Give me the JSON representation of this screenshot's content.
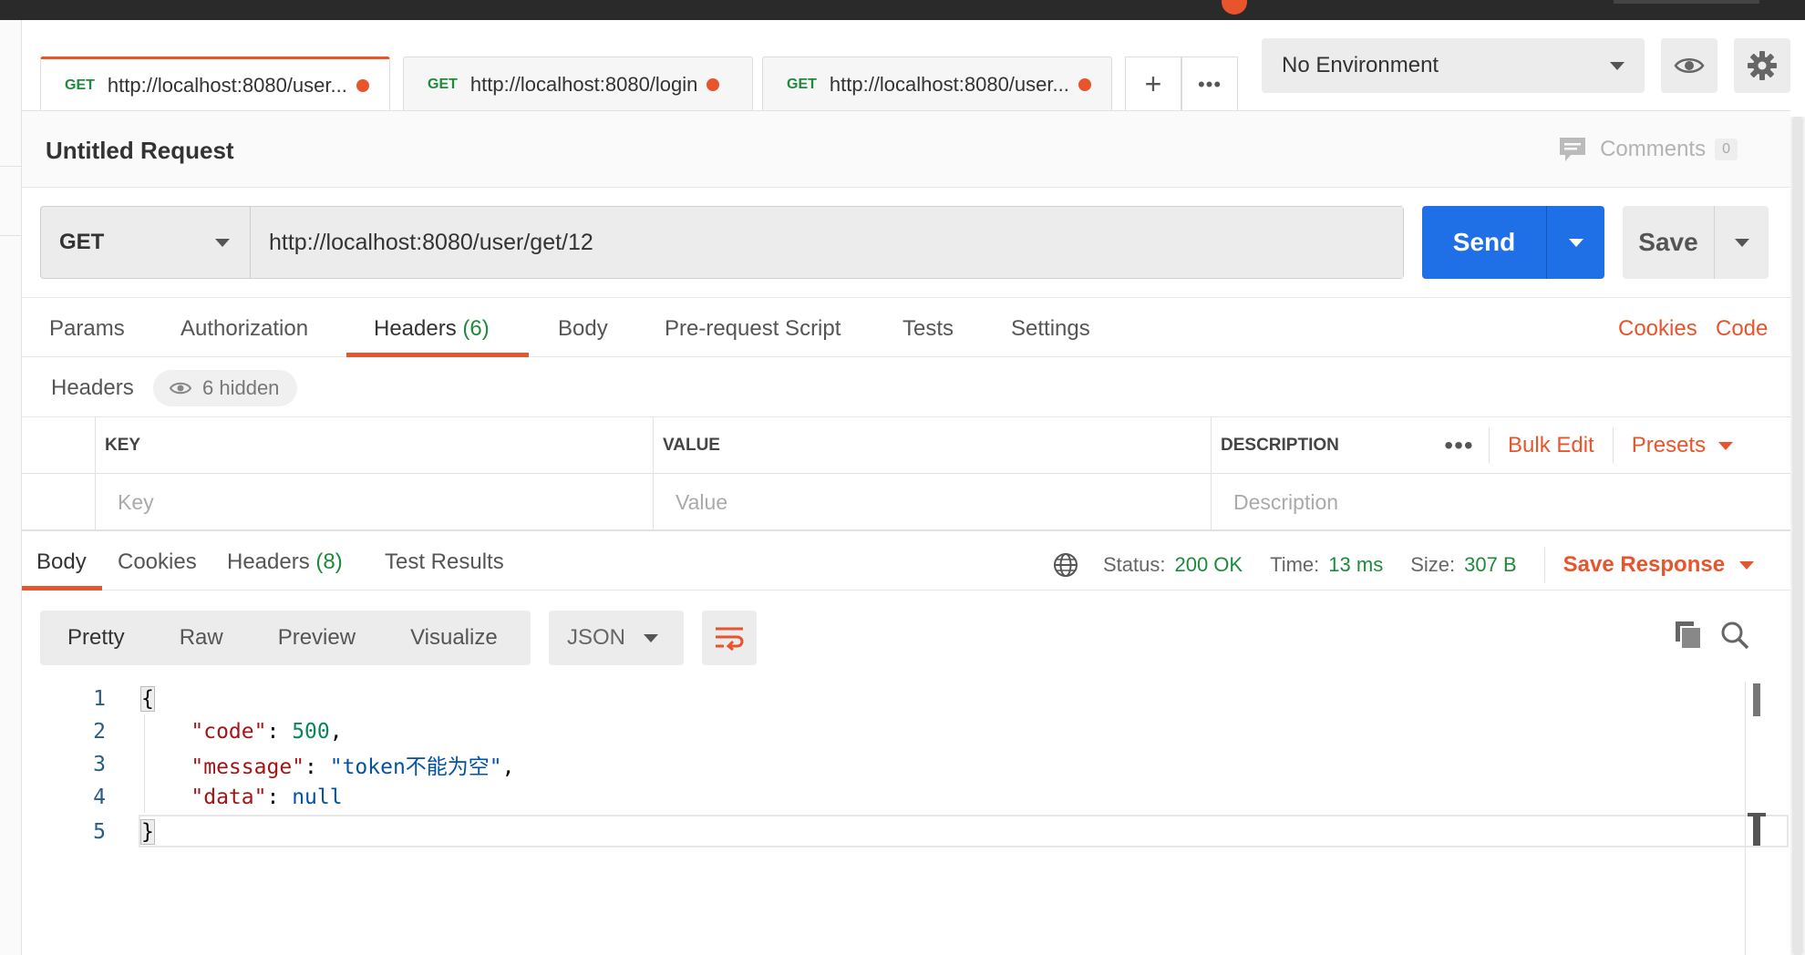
{
  "tabs": [
    {
      "method": "GET",
      "url": "http://localhost:8080/user..."
    },
    {
      "method": "GET",
      "url": "http://localhost:8080/login"
    },
    {
      "method": "GET",
      "url": "http://localhost:8080/user..."
    }
  ],
  "tab_controls": {
    "add": "+",
    "more": "•••"
  },
  "environment": {
    "selected": "No Environment"
  },
  "request": {
    "title": "Untitled Request",
    "comments_label": "Comments",
    "comments_count": "0",
    "method": "GET",
    "url": "http://localhost:8080/user/get/12",
    "send_label": "Send",
    "save_label": "Save"
  },
  "request_tabs": {
    "params": "Params",
    "authorization": "Authorization",
    "headers": "Headers",
    "headers_count": "(6)",
    "body": "Body",
    "prerequest": "Pre-request Script",
    "tests": "Tests",
    "settings": "Settings",
    "cookies_link": "Cookies",
    "code_link": "Code"
  },
  "headers_section": {
    "label": "Headers",
    "hidden_label": "6 hidden",
    "columns": {
      "key": "KEY",
      "value": "VALUE",
      "description": "DESCRIPTION"
    },
    "placeholders": {
      "key": "Key",
      "value": "Value",
      "description": "Description"
    },
    "bulk_edit": "Bulk Edit",
    "presets": "Presets",
    "more": "•••"
  },
  "response_tabs": {
    "body": "Body",
    "cookies": "Cookies",
    "headers": "Headers",
    "headers_count": "(8)",
    "test_results": "Test Results"
  },
  "response_meta": {
    "status_label": "Status:",
    "status_value": "200 OK",
    "time_label": "Time:",
    "time_value": "13 ms",
    "size_label": "Size:",
    "size_value": "307 B",
    "save_response": "Save Response"
  },
  "view_modes": [
    "Pretty",
    "Raw",
    "Preview",
    "Visualize"
  ],
  "format": "JSON",
  "code_lines": {
    "numbers": [
      "1",
      "2",
      "3",
      "4",
      "5"
    ],
    "open_brace": "{",
    "close_brace": "}",
    "l2_key": "\"code\"",
    "l2_val": "500",
    "l3_key": "\"message\"",
    "l3_val": "\"token不能为空\"",
    "l4_key": "\"data\"",
    "l4_val": "null",
    "colon": ": ",
    "comma": ","
  },
  "colors": {
    "accent": "#e8542c",
    "send": "#1f6fe6",
    "success": "#1e8a3c"
  }
}
